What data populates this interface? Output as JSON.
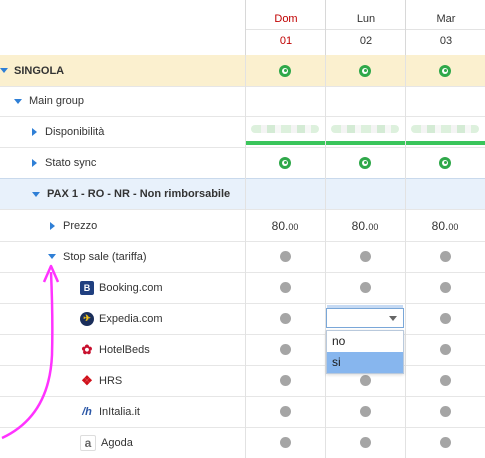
{
  "days": [
    {
      "name": "Dom",
      "num": "01",
      "color": "#c00000"
    },
    {
      "name": "Lun",
      "num": "02",
      "color": "#444444"
    },
    {
      "name": "Mar",
      "num": "03",
      "color": "#444444"
    }
  ],
  "rows": {
    "singola": "SINGOLA",
    "main_group": "Main group",
    "disponibilita": "Disponibilità",
    "stato_sync": "Stato sync",
    "pax": "PAX 1 - RO - NR - Non rimborsabile",
    "prezzo": "Prezzo",
    "stop_sale": "Stop sale (tariffa)"
  },
  "prices": [
    {
      "int": "80.",
      "dec": "00"
    },
    {
      "int": "80.",
      "dec": "00"
    },
    {
      "int": "80.",
      "dec": "00"
    }
  ],
  "channels": [
    {
      "label": "Booking.com",
      "icon": "booking-icon",
      "color": "#1f3f7f",
      "glyph": "B"
    },
    {
      "label": "Expedia.com",
      "icon": "expedia-icon",
      "color": "#1a2e5a",
      "glyph": "✈"
    },
    {
      "label": "HotelBeds",
      "icon": "hotelbeds-icon",
      "color": "#c8102e",
      "glyph": "✿"
    },
    {
      "label": "HRS",
      "icon": "hrs-icon",
      "color": "#d0101a",
      "glyph": "❖"
    },
    {
      "label": "InItalia.it",
      "icon": "initalia-icon",
      "color": "#2a56a6",
      "glyph": "/h"
    },
    {
      "label": "Agoda",
      "icon": "agoda-icon",
      "color": "#888888",
      "glyph": "a"
    }
  ],
  "dropdown": {
    "value": "",
    "options": [
      "no",
      "si"
    ],
    "selected": "si"
  },
  "colors": {
    "singola_bg": "#fbf0cf",
    "pax_bg": "#e8f1fb",
    "accent_blue": "#2f7fd6",
    "annotation_arrow": "#ff33ff"
  }
}
